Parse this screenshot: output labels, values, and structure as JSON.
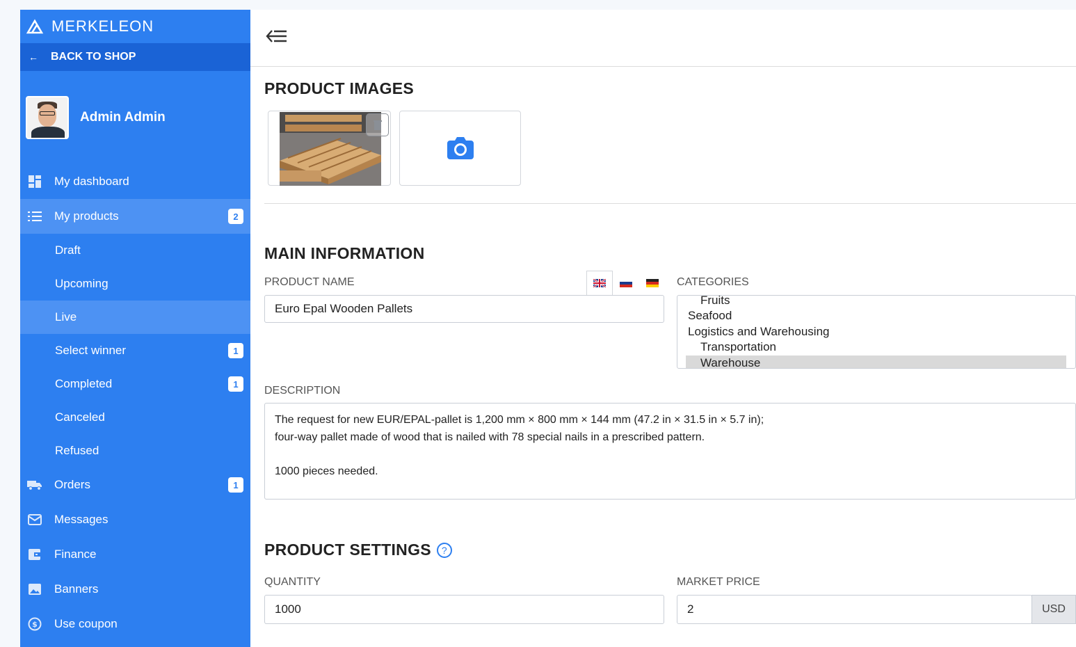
{
  "brand": {
    "name": "MERKELEON"
  },
  "sidebar": {
    "back_label": "BACK TO SHOP",
    "user_name": "Admin Admin",
    "items": [
      {
        "label": "My dashboard",
        "icon": "dashboard-icon"
      },
      {
        "label": "My products",
        "icon": "list-icon",
        "badge": "2"
      },
      {
        "label": "Orders",
        "icon": "truck-icon",
        "badge": "1"
      },
      {
        "label": "Messages",
        "icon": "envelope-icon"
      },
      {
        "label": "Finance",
        "icon": "wallet-icon"
      },
      {
        "label": "Banners",
        "icon": "image-icon"
      },
      {
        "label": "Use coupon",
        "icon": "coin-icon"
      }
    ],
    "sub_items": [
      {
        "label": "Draft"
      },
      {
        "label": "Upcoming"
      },
      {
        "label": "Live"
      },
      {
        "label": "Select winner",
        "badge": "1"
      },
      {
        "label": "Completed",
        "badge": "1"
      },
      {
        "label": "Canceled"
      },
      {
        "label": "Refused"
      }
    ]
  },
  "main": {
    "images_title": "PRODUCT IMAGES",
    "main_info_title": "MAIN INFORMATION",
    "product_name_label": "PRODUCT NAME",
    "product_name_value": "Euro Epal Wooden Pallets",
    "categories_label": "CATEGORIES",
    "categories": [
      "Fruits",
      "Seafood",
      "Logistics and Warehousing",
      "Transportation",
      "Warehouse"
    ],
    "description_label": "DESCRIPTION",
    "description_lines": [
      "The request for new EUR/EPAL-pallet is 1,200 mm × 800 mm × 144 mm (47.2 in × 31.5 in × 5.7 in);",
      "four-way pallet made of wood that is nailed with 78 special nails in a prescribed pattern.",
      "1000 pieces needed."
    ],
    "settings_title": "PRODUCT SETTINGS",
    "quantity_label": "QUANTITY",
    "quantity_value": "1000",
    "market_price_label": "MARKET PRICE",
    "market_price_value": "2",
    "currency": "USD"
  },
  "colors": {
    "accent": "#2d7ff0",
    "sidebar_dark": "#1a63d6",
    "active": "#4d92f3"
  }
}
